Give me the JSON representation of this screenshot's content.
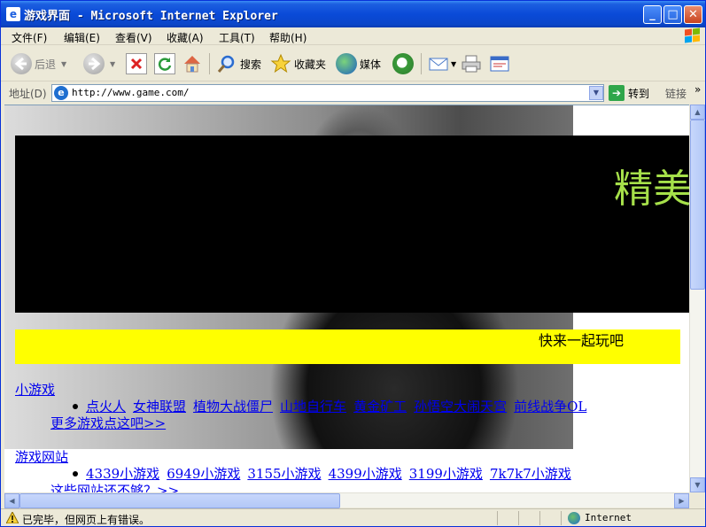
{
  "window": {
    "title": "游戏界面 - Microsoft Internet Explorer",
    "min_glyph": "_",
    "max_glyph": "□",
    "close_glyph": "✕"
  },
  "menu": {
    "items": [
      {
        "label": "文件(F)"
      },
      {
        "label": "编辑(E)"
      },
      {
        "label": "查看(V)"
      },
      {
        "label": "收藏(A)"
      },
      {
        "label": "工具(T)"
      },
      {
        "label": "帮助(H)"
      }
    ]
  },
  "toolbar": {
    "back_label": "后退",
    "search_label": "搜索",
    "favorites_label": "收藏夹",
    "media_label": "媒体"
  },
  "address": {
    "label": "地址(D)",
    "url": "http://www.game.com/",
    "go_label": "转到",
    "links_label": "链接",
    "chevron": "»"
  },
  "page": {
    "headline": "精美",
    "banner_text": "快来一起玩吧",
    "sections": [
      {
        "title": "小游戏",
        "items": [
          "点火人",
          "女神联盟",
          "植物大战僵尸",
          "山地自行车",
          "黄金矿工",
          "孙悟空大闹天宫",
          "前线战争OL"
        ],
        "more": "更多游戏点这吧>>"
      },
      {
        "title": "游戏网站",
        "items": [
          "4339小游戏",
          "6949小游戏",
          "3155小游戏",
          "4399小游戏",
          "3199小游戏",
          "7k7k7小游戏"
        ],
        "more": "这些网站还不够？>>"
      }
    ]
  },
  "status": {
    "text": "已完毕，但网页上有错误。",
    "zone": "Internet"
  },
  "colors": {
    "headline": "#a6e04a",
    "banner": "#ffff00",
    "link": "#0000ee"
  }
}
